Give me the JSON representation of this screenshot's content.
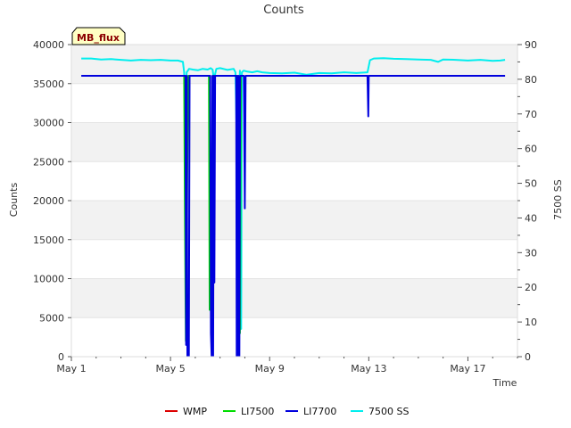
{
  "chart_data": {
    "type": "line",
    "title": "Counts",
    "badge": "MB_flux",
    "xlabel": "Time",
    "ylabel": "Counts",
    "y2label": "7500 SS",
    "x_tick_labels": [
      "May 1",
      "May 5",
      "May 9",
      "May 13",
      "May 17"
    ],
    "x_tick_days": [
      1,
      5,
      9,
      13,
      17
    ],
    "xlim": [
      1,
      19
    ],
    "ylim": [
      0,
      40000
    ],
    "y_ticks": [
      0,
      5000,
      10000,
      15000,
      20000,
      25000,
      30000,
      35000,
      40000
    ],
    "y2lim": [
      0,
      90
    ],
    "y2_ticks": [
      0,
      10,
      20,
      30,
      40,
      50,
      60,
      70,
      80,
      90
    ],
    "grid": "horizontal bands",
    "legend_position": "bottom",
    "series": [
      {
        "name": "WMP",
        "color": "#dd0000",
        "axis": "left",
        "x": [],
        "y": []
      },
      {
        "name": "LI7500",
        "color": "#00dd00",
        "axis": "left",
        "x": [
          5.55,
          5.58,
          5.62,
          5.68,
          5.72,
          5.75,
          6.55,
          6.58,
          6.62,
          6.66,
          6.72,
          6.76,
          7.7,
          7.73,
          7.76,
          7.8,
          7.84,
          7.88
        ],
        "y": [
          36000,
          20000,
          2000,
          25000,
          36000,
          36000,
          36000,
          6000,
          20000,
          5000,
          36000,
          36000,
          36000,
          10000,
          30000,
          3000,
          36000,
          36000
        ]
      },
      {
        "name": "LI7700",
        "color": "#0000dd",
        "axis": "left",
        "x": [
          1.4,
          5.6,
          5.63,
          5.66,
          5.68,
          5.71,
          5.74,
          5.77,
          5.8,
          6.6,
          6.63,
          6.66,
          6.69,
          6.72,
          6.75,
          6.77,
          6.8,
          7.65,
          7.67,
          7.7,
          7.72,
          7.75,
          7.78,
          7.81,
          7.84,
          7.9,
          7.96,
          8.0,
          8.03,
          8.06,
          8.09,
          12.95,
          12.98,
          13.0,
          13.03,
          13.06,
          18.5
        ],
        "y": [
          36000,
          36000,
          1500,
          36000,
          0,
          1500,
          0,
          36000,
          36000,
          36000,
          3000,
          0,
          36000,
          0,
          36000,
          9500,
          36000,
          36000,
          0,
          36000,
          0,
          36000,
          0,
          36000,
          36000,
          36000,
          36000,
          19000,
          36000,
          36000,
          36000,
          36000,
          30800,
          36000,
          36000,
          36000,
          36000
        ]
      },
      {
        "name": "7500 SS",
        "color": "#00eeee",
        "axis": "right",
        "x": [
          1.4,
          1.8,
          2.2,
          2.6,
          3.0,
          3.4,
          3.8,
          4.2,
          4.6,
          5.0,
          5.3,
          5.5,
          5.55,
          5.6,
          5.65,
          5.7,
          5.75,
          5.9,
          6.1,
          6.3,
          6.5,
          6.62,
          6.7,
          6.75,
          6.85,
          7.0,
          7.3,
          7.55,
          7.62,
          7.68,
          7.72,
          7.76,
          7.8,
          7.85,
          7.88,
          7.95,
          8.1,
          8.3,
          8.5,
          8.7,
          9.0,
          9.5,
          10.0,
          10.5,
          11.0,
          11.5,
          12.0,
          12.5,
          12.95,
          13.05,
          13.2,
          13.6,
          14.0,
          14.5,
          15.0,
          15.5,
          15.8,
          16.0,
          16.5,
          17.0,
          17.5,
          18.0,
          18.3,
          18.5
        ],
        "y": [
          86,
          86,
          85.7,
          85.8,
          85.6,
          85.4,
          85.6,
          85.5,
          85.6,
          85.4,
          85.4,
          85.0,
          82.0,
          70.0,
          82.0,
          82.5,
          83.0,
          82.8,
          82.6,
          83.0,
          82.8,
          83.2,
          82.8,
          80.0,
          83.0,
          83.2,
          82.7,
          83.0,
          82.0,
          60.0,
          20.0,
          70.0,
          82.5,
          8.0,
          82.0,
          82.5,
          82.2,
          82.0,
          82.3,
          82.0,
          81.8,
          81.7,
          81.9,
          81.3,
          81.8,
          81.7,
          82.0,
          81.8,
          82.0,
          85.5,
          86.0,
          86.1,
          85.9,
          85.8,
          85.7,
          85.6,
          85.0,
          85.7,
          85.6,
          85.4,
          85.6,
          85.3,
          85.4,
          85.6
        ]
      }
    ]
  }
}
